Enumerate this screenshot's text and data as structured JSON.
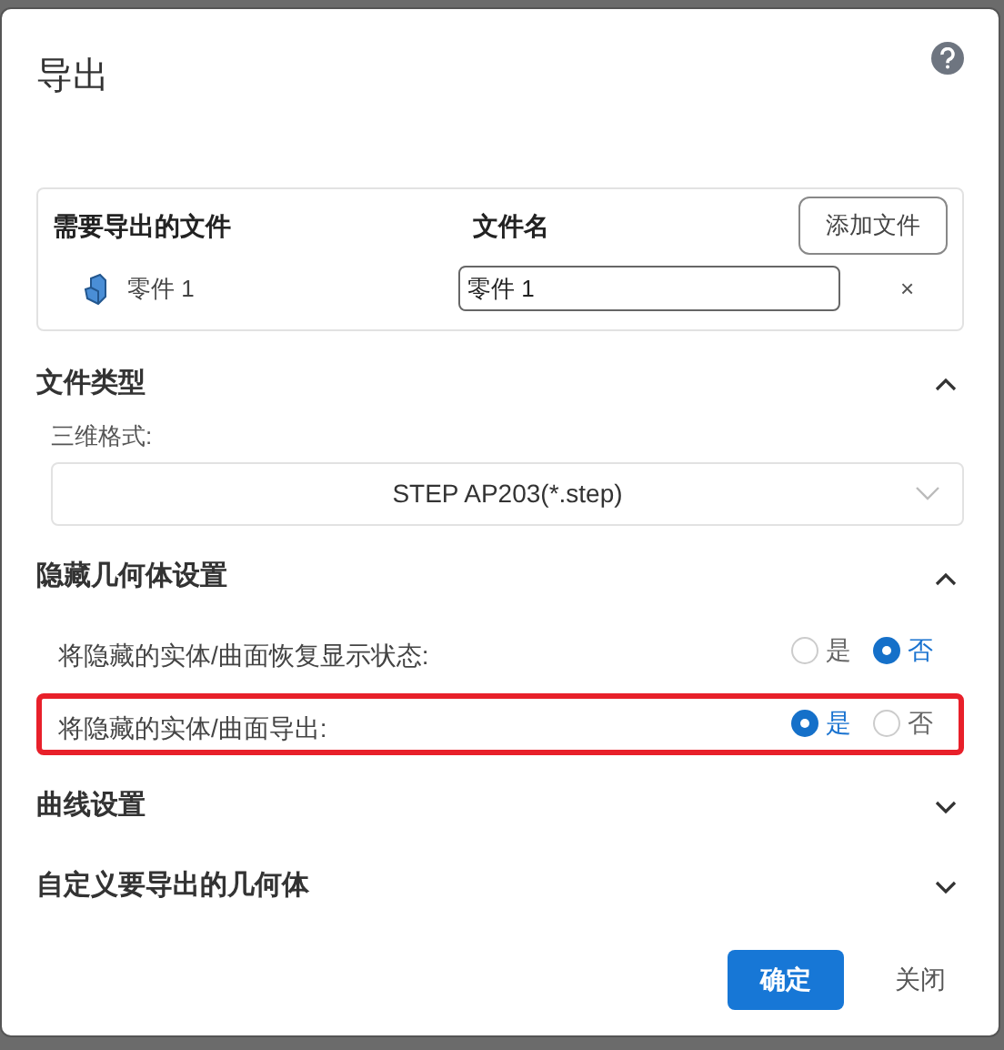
{
  "dialog": {
    "title": "导出"
  },
  "files": {
    "columns": [
      "需要导出的文件",
      "文件名"
    ],
    "add_button": "添加文件",
    "rows": [
      {
        "name": "零件 1",
        "filename": "零件 1",
        "remove": "×"
      }
    ]
  },
  "sections": [
    {
      "title": "文件类型",
      "expanded": true,
      "kind": "format",
      "label": "三维格式:",
      "value": "STEP AP203(*.step)"
    },
    {
      "title": "隐藏几何体设置",
      "expanded": true,
      "kind": "options",
      "options": [
        {
          "label": "将隐藏的实体/曲面恢复显示状态:",
          "highlighted": false,
          "choices": [
            {
              "label": "是",
              "selected": false
            },
            {
              "label": "否",
              "selected": true
            }
          ]
        },
        {
          "label": "将隐藏的实体/曲面导出:",
          "highlighted": true,
          "choices": [
            {
              "label": "是",
              "selected": true
            },
            {
              "label": "否",
              "selected": false
            }
          ]
        }
      ]
    },
    {
      "title": "曲线设置",
      "expanded": false
    },
    {
      "title": "自定义要导出的几何体",
      "expanded": false
    }
  ],
  "buttons": {
    "confirm": "确定",
    "close": "关闭"
  }
}
